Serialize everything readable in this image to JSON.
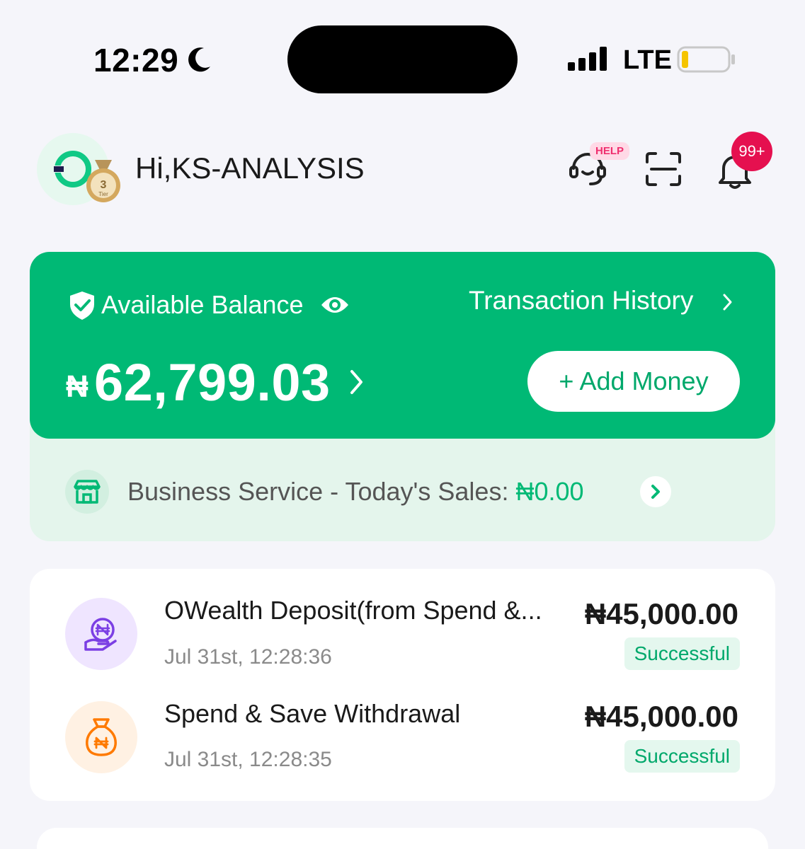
{
  "status_bar": {
    "time": "12:29",
    "network": "LTE"
  },
  "header": {
    "greeting": "Hi,KS-ANALYSIS",
    "tier_number": "3",
    "tier_label": "Tier",
    "help_tag": "HELP",
    "notification_count": "99+"
  },
  "balance": {
    "label": "Available Balance",
    "currency_symbol": "₦",
    "amount": "62,799.03",
    "transaction_history_label": "Transaction History",
    "add_money_label": "+ Add Money"
  },
  "business": {
    "label": "Business Service - Today's Sales: ",
    "amount": "₦0.00"
  },
  "transactions": [
    {
      "title": "OWealth Deposit(from Spend &...",
      "time": "Jul 31st, 12:28:36",
      "amount": "₦45,000.00",
      "status": "Successful"
    },
    {
      "title": "Spend & Save Withdrawal",
      "time": "Jul 31st, 12:28:35",
      "amount": "₦45,000.00",
      "status": "Successful"
    }
  ],
  "colors": {
    "brand_green": "#00b975",
    "light_green": "#e4f5ec",
    "badge_red": "#e5104f",
    "purple_bg": "#efe5ff",
    "orange_bg": "#fff1e3"
  }
}
